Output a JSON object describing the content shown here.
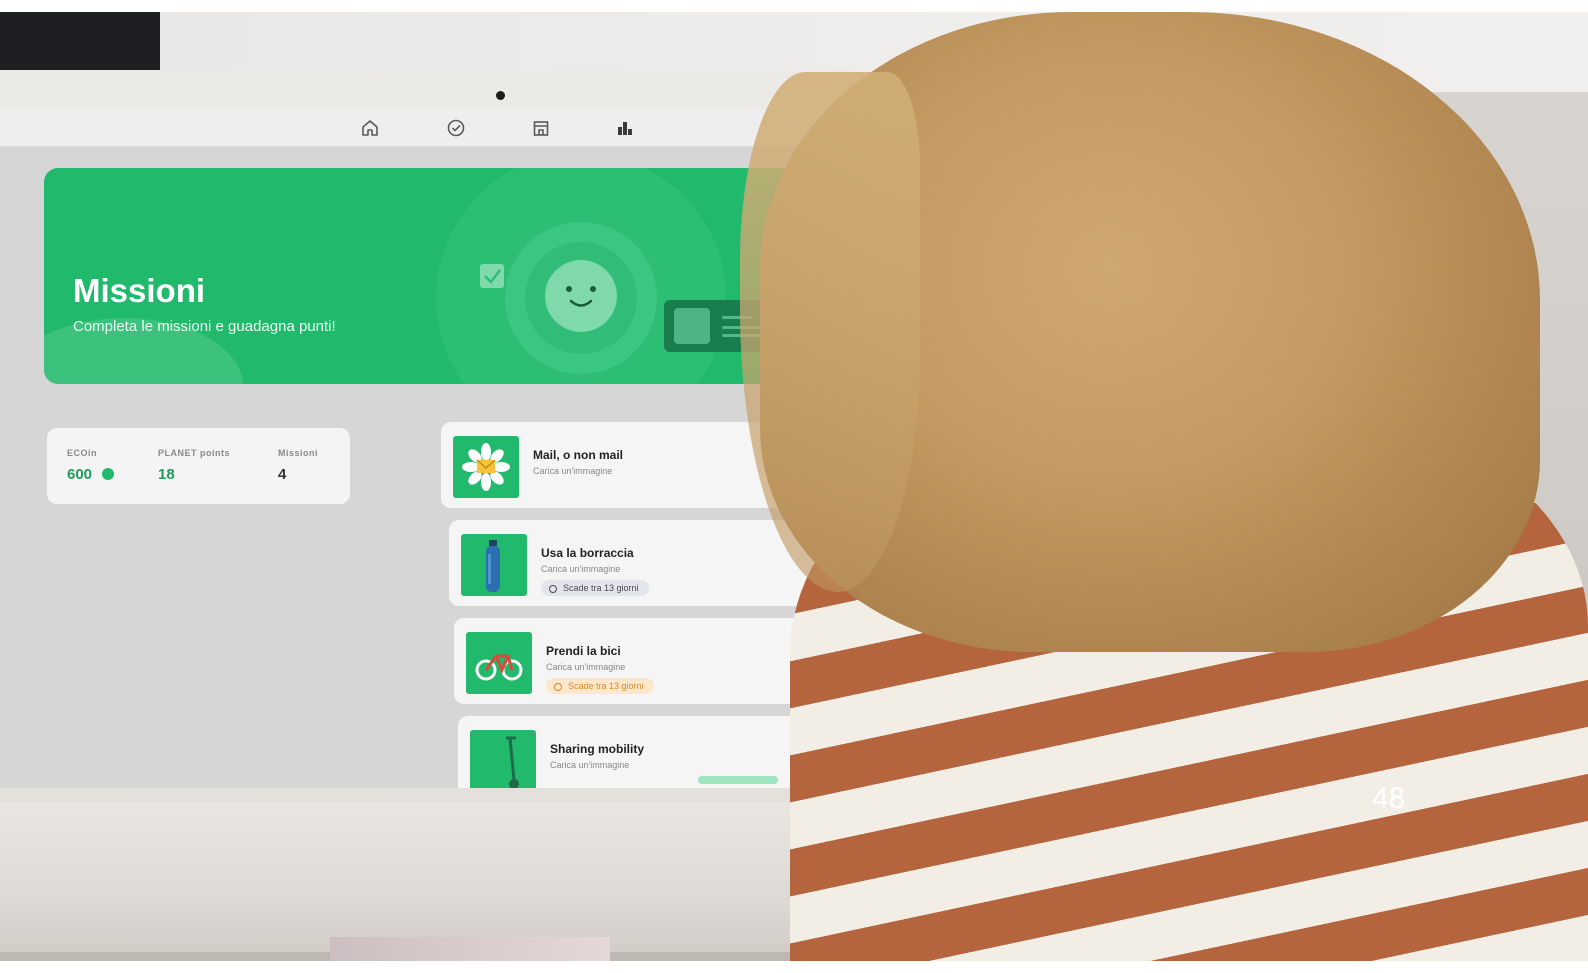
{
  "nav": {
    "icons": [
      "home-icon",
      "check-circle-icon",
      "store-icon",
      "leaderboard-icon"
    ]
  },
  "hero": {
    "title": "Missioni",
    "subtitle": "Completa le missioni e guadagna punti!"
  },
  "stats": [
    {
      "label": "ECOin",
      "value": "600"
    },
    {
      "label": "PLANET points",
      "value": "18"
    },
    {
      "label": "Missioni",
      "value": "4"
    }
  ],
  "missions": [
    {
      "title": "Mail, o non mail",
      "subtitle": "Carica un'immagine",
      "icon": "envelope-flower-icon"
    },
    {
      "title": "Usa la borraccia",
      "subtitle": "Carica un'immagine",
      "badge": "Scade tra 13 giorni",
      "icon": "water-bottle-icon"
    },
    {
      "title": "Prendi la bici",
      "subtitle": "Carica un'immagine",
      "badge": "Scade tra 13 giorni",
      "icon": "bicycle-icon"
    },
    {
      "title": "Sharing mobility",
      "subtitle": "Carica un'immagine",
      "icon": "scooter-icon"
    }
  ],
  "colors": {
    "brand_green": "#21ba6c",
    "badge_orange": "#fde7cc",
    "badge_gray": "#e4e4ec"
  },
  "page_number": "48"
}
